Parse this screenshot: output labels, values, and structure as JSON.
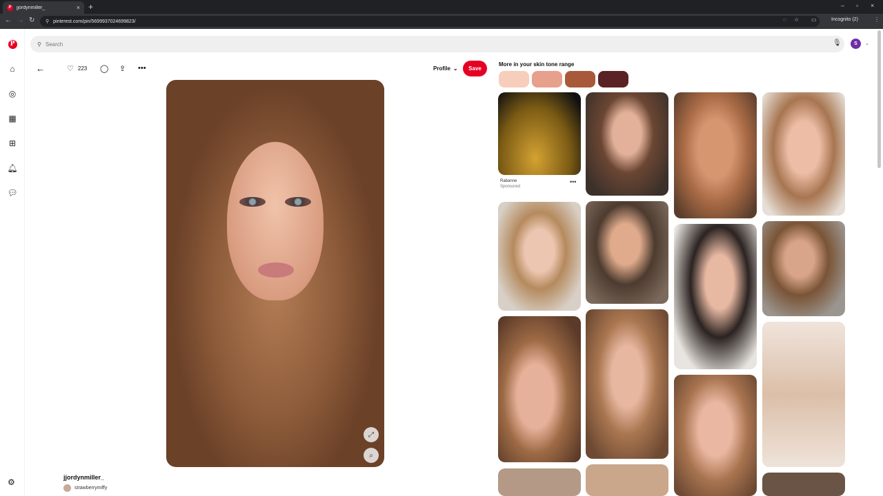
{
  "browser": {
    "tab_title": "jjordynmiller_",
    "favicon_letter": "P",
    "url": "pinterest.com/pin/5699937024699823/",
    "incognito_label": "Incognito (2)"
  },
  "search": {
    "placeholder": "Search"
  },
  "account": {
    "initial": "S",
    "color": "#6f2fa3"
  },
  "pin": {
    "like_count": "223",
    "profile_label": "Profile",
    "save_label": "Save",
    "author": "jjordynmiller_",
    "sub_user": "strawberrymiffy"
  },
  "related": {
    "title": "More in your skin tone range",
    "swatches": [
      "#f7cdbb",
      "#e6a08c",
      "#a8593a",
      "#5b2226"
    ],
    "ad": {
      "brand": "Rabanne",
      "label": "Sponsored"
    }
  },
  "colors": {
    "brand": "#e60023"
  }
}
